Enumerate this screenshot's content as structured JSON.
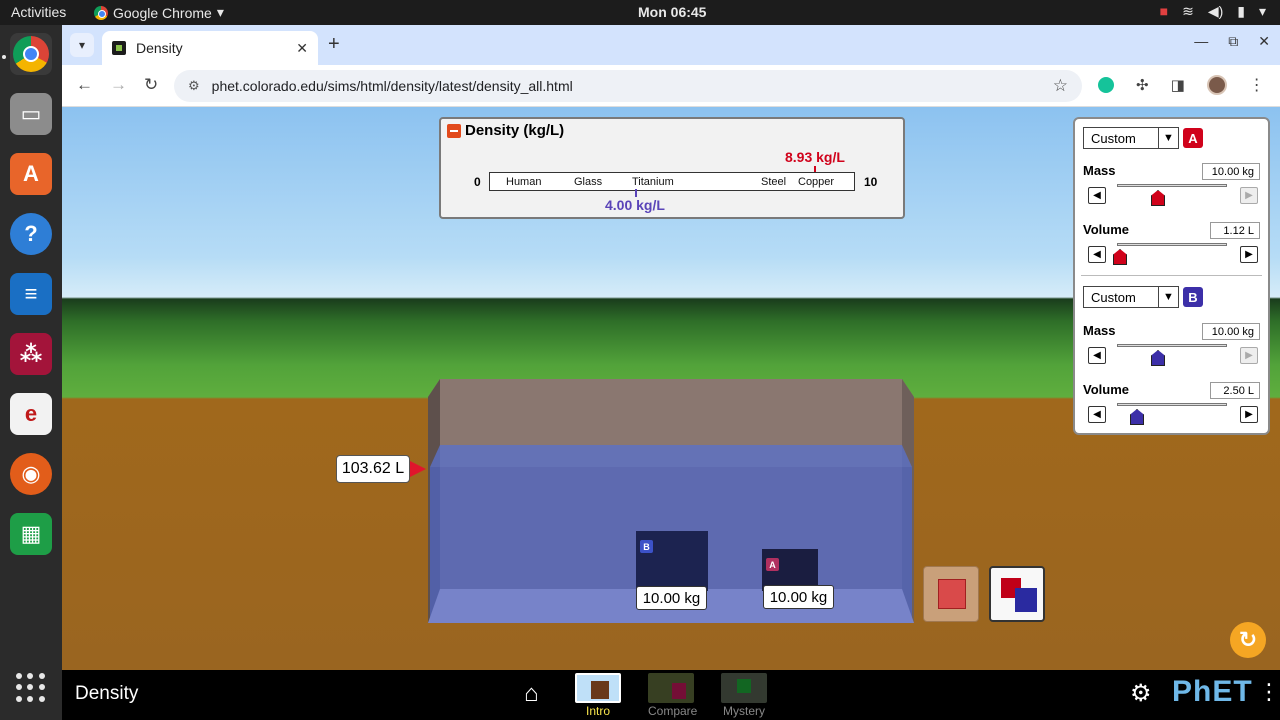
{
  "os_topbar": {
    "activities": "Activities",
    "app_name": "Google Chrome",
    "clock": "Mon 06:45"
  },
  "browser": {
    "tab_title": "Density",
    "url": "phet.colorado.edu/sims/html/density/latest/density_all.html"
  },
  "density_panel": {
    "title": "Density (kg/L)",
    "min": "0",
    "max": "10",
    "materials": [
      "Human",
      "Glass",
      "Titanium",
      "Steel",
      "Copper"
    ],
    "block_a_density": "8.93 kg/L",
    "block_b_density": "4.00 kg/L"
  },
  "controls": {
    "block_a": {
      "material": "Custom",
      "badge": "A",
      "mass_label": "Mass",
      "mass_value": "10.00 kg",
      "volume_label": "Volume",
      "volume_value": "1.12 L"
    },
    "block_b": {
      "material": "Custom",
      "badge": "B",
      "mass_label": "Mass",
      "mass_value": "10.00 kg",
      "volume_label": "Volume",
      "volume_value": "2.50 L"
    }
  },
  "scene": {
    "pool_volume": "103.62 L",
    "block_b_tag": "B",
    "block_b_mass": "10.00 kg",
    "block_a_tag": "A",
    "block_a_mass": "10.00 kg"
  },
  "navbar": {
    "sim_title": "Density",
    "screens": [
      "Intro",
      "Compare",
      "Mystery"
    ],
    "brand": "PhET"
  },
  "colors": {
    "block_a": "#d0021b",
    "block_b": "#3c2fa8",
    "water": "#5a70c8",
    "ground": "#9a6520"
  }
}
